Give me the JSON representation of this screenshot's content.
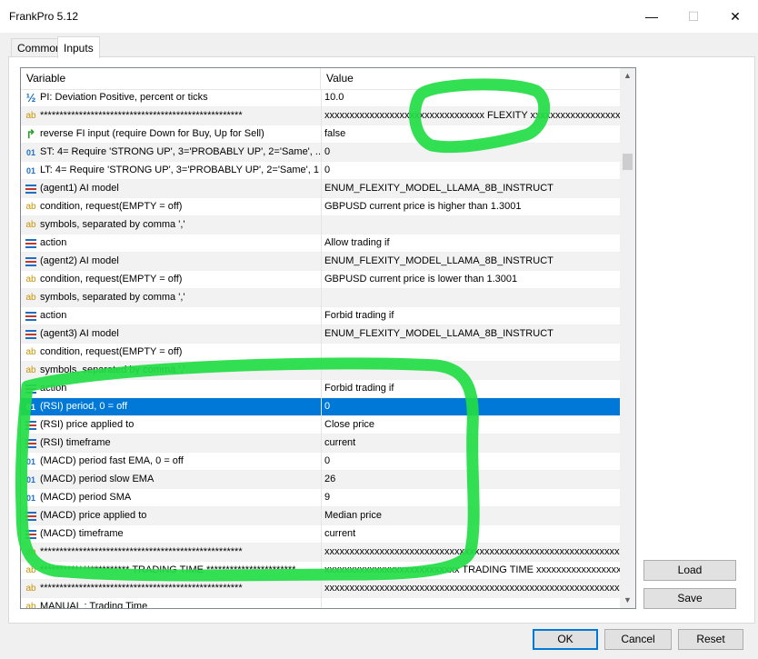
{
  "window": {
    "title": "FrankPro 5.12",
    "controls": {
      "minimize": "—",
      "maximize": "☐",
      "close": "✕"
    }
  },
  "tabs": [
    {
      "label": "Common",
      "active": false
    },
    {
      "label": "Inputs",
      "active": true
    }
  ],
  "grid": {
    "columns": {
      "variable": "Variable",
      "value": "Value"
    },
    "rows": [
      {
        "icon": "half",
        "variable": "PI: Deviation Positive, percent or ticks",
        "value": "10.0"
      },
      {
        "icon": "ab",
        "variable": "****************************************************",
        "value": "xxxxxxxxxxxxxxxxxxxxxxxxxxxxxxxx FLEXITY xxxxxxxxxxxxxxxxxxxxxxxxxxxxxxxx"
      },
      {
        "icon": "arrow",
        "variable": "reverse FI input (require Down for Buy, Up for Sell)",
        "value": "false"
      },
      {
        "icon": "num",
        "variable": "ST: 4= Require 'STRONG UP', 3='PROBABLY UP', 2='Same', ...",
        "value": "0"
      },
      {
        "icon": "num",
        "variable": "LT: 4= Require 'STRONG UP', 3='PROBABLY UP', 2='Same', 1...",
        "value": "0"
      },
      {
        "icon": "enum",
        "variable": "(agent1) AI model",
        "value": "ENUM_FLEXITY_MODEL_LLAMA_8B_INSTRUCT"
      },
      {
        "icon": "ab",
        "variable": "condition, request(EMPTY = off)",
        "value": "GBPUSD current price is higher than 1.3001"
      },
      {
        "icon": "ab",
        "variable": "symbols, separated by comma ','",
        "value": ""
      },
      {
        "icon": "enum",
        "variable": "action",
        "value": "Allow trading if"
      },
      {
        "icon": "enum",
        "variable": "(agent2) AI model",
        "value": "ENUM_FLEXITY_MODEL_LLAMA_8B_INSTRUCT"
      },
      {
        "icon": "ab",
        "variable": "condition, request(EMPTY = off)",
        "value": "GBPUSD current price is lower than 1.3001"
      },
      {
        "icon": "ab",
        "variable": "symbols, separated by comma ','",
        "value": ""
      },
      {
        "icon": "enum",
        "variable": "action",
        "value": "Forbid trading if"
      },
      {
        "icon": "enum",
        "variable": "(agent3) AI model",
        "value": "ENUM_FLEXITY_MODEL_LLAMA_8B_INSTRUCT"
      },
      {
        "icon": "ab",
        "variable": "condition, request(EMPTY = off)",
        "value": ""
      },
      {
        "icon": "ab",
        "variable": "symbols, separated by comma ','",
        "value": ""
      },
      {
        "icon": "enum",
        "variable": "action",
        "value": "Forbid trading if"
      },
      {
        "icon": "num",
        "variable": "(RSI) period, 0 = off",
        "value": "0",
        "selected": true
      },
      {
        "icon": "enum",
        "variable": "(RSI) price applied to",
        "value": "Close price"
      },
      {
        "icon": "enum",
        "variable": "(RSI) timeframe",
        "value": "current"
      },
      {
        "icon": "num",
        "variable": "(MACD) period fast EMA, 0 = off",
        "value": "0"
      },
      {
        "icon": "num",
        "variable": "(MACD) period slow EMA",
        "value": "26"
      },
      {
        "icon": "num",
        "variable": "(MACD) period SMA",
        "value": "9"
      },
      {
        "icon": "enum",
        "variable": "(MACD) price applied to",
        "value": "Median price"
      },
      {
        "icon": "enum",
        "variable": "(MACD) timeframe",
        "value": "current"
      },
      {
        "icon": "ab",
        "variable": "****************************************************",
        "value": "xxxxxxxxxxxxxxxxxxxxxxxxxxxxxxxxxxxxxxxxxxxxxxxxxxxxxxxxxxxxxxxx"
      },
      {
        "icon": "ab",
        "variable": "*********************** TRADING TIME ***********************",
        "value": "xxxxxxxxxxxxxxxxxxxxxxxxxxx TRADING TIME xxxxxxxxxxxxxxxxxxxxxxxxxxx"
      },
      {
        "icon": "ab",
        "variable": "****************************************************",
        "value": "xxxxxxxxxxxxxxxxxxxxxxxxxxxxxxxxxxxxxxxxxxxxxxxxxxxxxxxxxxxxxxxx"
      },
      {
        "icon": "ab",
        "variable": "                    MANUAL : Trading Time",
        "value": ""
      }
    ]
  },
  "buttons": {
    "load": "Load",
    "save": "Save",
    "ok": "OK",
    "cancel": "Cancel",
    "reset": "Reset"
  },
  "scrollbar": {
    "up": "▲",
    "down": "▼"
  },
  "colors": {
    "selection": "#0078d7",
    "highlight_marker": "#22dd44"
  }
}
